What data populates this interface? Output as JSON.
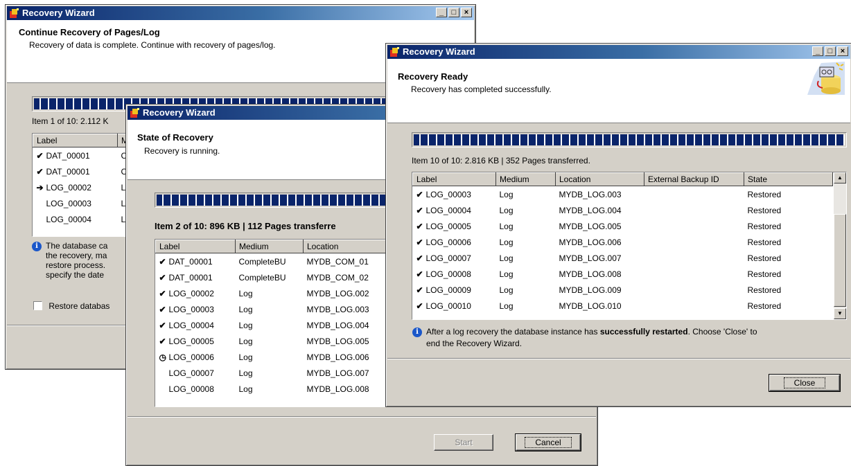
{
  "window1": {
    "title": "Recovery Wizard",
    "heading": "Continue Recovery of Pages/Log",
    "subheading": "Recovery of data is complete. Continue with recovery of pages/log.",
    "progress_text": "Item 1 of 10: 2.112 K",
    "columns": [
      "Label",
      "M"
    ],
    "rows": [
      {
        "mark": "✔",
        "label": "DAT_00001",
        "medium": "C"
      },
      {
        "mark": "✔",
        "label": "DAT_00001",
        "medium": "C"
      },
      {
        "mark": "➔",
        "label": "LOG_00002",
        "medium": "L"
      },
      {
        "mark": "",
        "label": "LOG_00003",
        "medium": "L"
      },
      {
        "mark": "",
        "label": "LOG_00004",
        "medium": "L"
      }
    ],
    "info_lines": [
      "The database ca",
      "the recovery, ma",
      "restore process.",
      "specify the date"
    ],
    "checkbox_label": "Restore databas"
  },
  "window2": {
    "title": "Recovery Wizard",
    "heading": "State of Recovery",
    "subheading": "Recovery is running.",
    "progress_text": "Item 2 of 10: 896 KB | 112 Pages transferre",
    "columns": [
      "Label",
      "Medium",
      "Location"
    ],
    "rows": [
      {
        "mark": "✔",
        "label": "DAT_00001",
        "medium": "CompleteBU",
        "location": "MYDB_COM_01"
      },
      {
        "mark": "✔",
        "label": "DAT_00001",
        "medium": "CompleteBU",
        "location": "MYDB_COM_02"
      },
      {
        "mark": "✔",
        "label": "LOG_00002",
        "medium": "Log",
        "location": "MYDB_LOG.002"
      },
      {
        "mark": "✔",
        "label": "LOG_00003",
        "medium": "Log",
        "location": "MYDB_LOG.003"
      },
      {
        "mark": "✔",
        "label": "LOG_00004",
        "medium": "Log",
        "location": "MYDB_LOG.004"
      },
      {
        "mark": "✔",
        "label": "LOG_00005",
        "medium": "Log",
        "location": "MYDB_LOG.005"
      },
      {
        "mark": "◷",
        "label": "LOG_00006",
        "medium": "Log",
        "location": "MYDB_LOG.006"
      },
      {
        "mark": "",
        "label": "LOG_00007",
        "medium": "Log",
        "location": "MYDB_LOG.007"
      },
      {
        "mark": "",
        "label": "LOG_00008",
        "medium": "Log",
        "location": "MYDB_LOG.008"
      }
    ],
    "start_label": "Start",
    "cancel_label": "Cancel"
  },
  "window3": {
    "title": "Recovery Wizard",
    "heading": "Recovery Ready",
    "subheading": "Recovery has completed successfully.",
    "progress_text": "Item 10 of 10: 2.816 KB | 352 Pages transferred.",
    "columns": [
      "Label",
      "Medium",
      "Location",
      "External Backup ID",
      "State"
    ],
    "rows": [
      {
        "mark": "✔",
        "label": "LOG_00003",
        "medium": "Log",
        "location": "MYDB_LOG.003",
        "ebid": "",
        "state": "Restored"
      },
      {
        "mark": "✔",
        "label": "LOG_00004",
        "medium": "Log",
        "location": "MYDB_LOG.004",
        "ebid": "",
        "state": "Restored"
      },
      {
        "mark": "✔",
        "label": "LOG_00005",
        "medium": "Log",
        "location": "MYDB_LOG.005",
        "ebid": "",
        "state": "Restored"
      },
      {
        "mark": "✔",
        "label": "LOG_00006",
        "medium": "Log",
        "location": "MYDB_LOG.006",
        "ebid": "",
        "state": "Restored"
      },
      {
        "mark": "✔",
        "label": "LOG_00007",
        "medium": "Log",
        "location": "MYDB_LOG.007",
        "ebid": "",
        "state": "Restored"
      },
      {
        "mark": "✔",
        "label": "LOG_00008",
        "medium": "Log",
        "location": "MYDB_LOG.008",
        "ebid": "",
        "state": "Restored"
      },
      {
        "mark": "✔",
        "label": "LOG_00009",
        "medium": "Log",
        "location": "MYDB_LOG.009",
        "ebid": "",
        "state": "Restored"
      },
      {
        "mark": "✔",
        "label": "LOG_00010",
        "medium": "Log",
        "location": "MYDB_LOG.010",
        "ebid": "",
        "state": "Restored"
      }
    ],
    "info_pre": "After a log recovery the database instance has ",
    "info_bold": "successfully restarted",
    "info_post": ". Choose 'Close' to",
    "info_line2": "end the Recovery Wizard.",
    "close_label": "Close"
  },
  "colors": {
    "titlebar": "#0a246a",
    "face": "#d4d0c8",
    "progress": "#0a246a"
  }
}
